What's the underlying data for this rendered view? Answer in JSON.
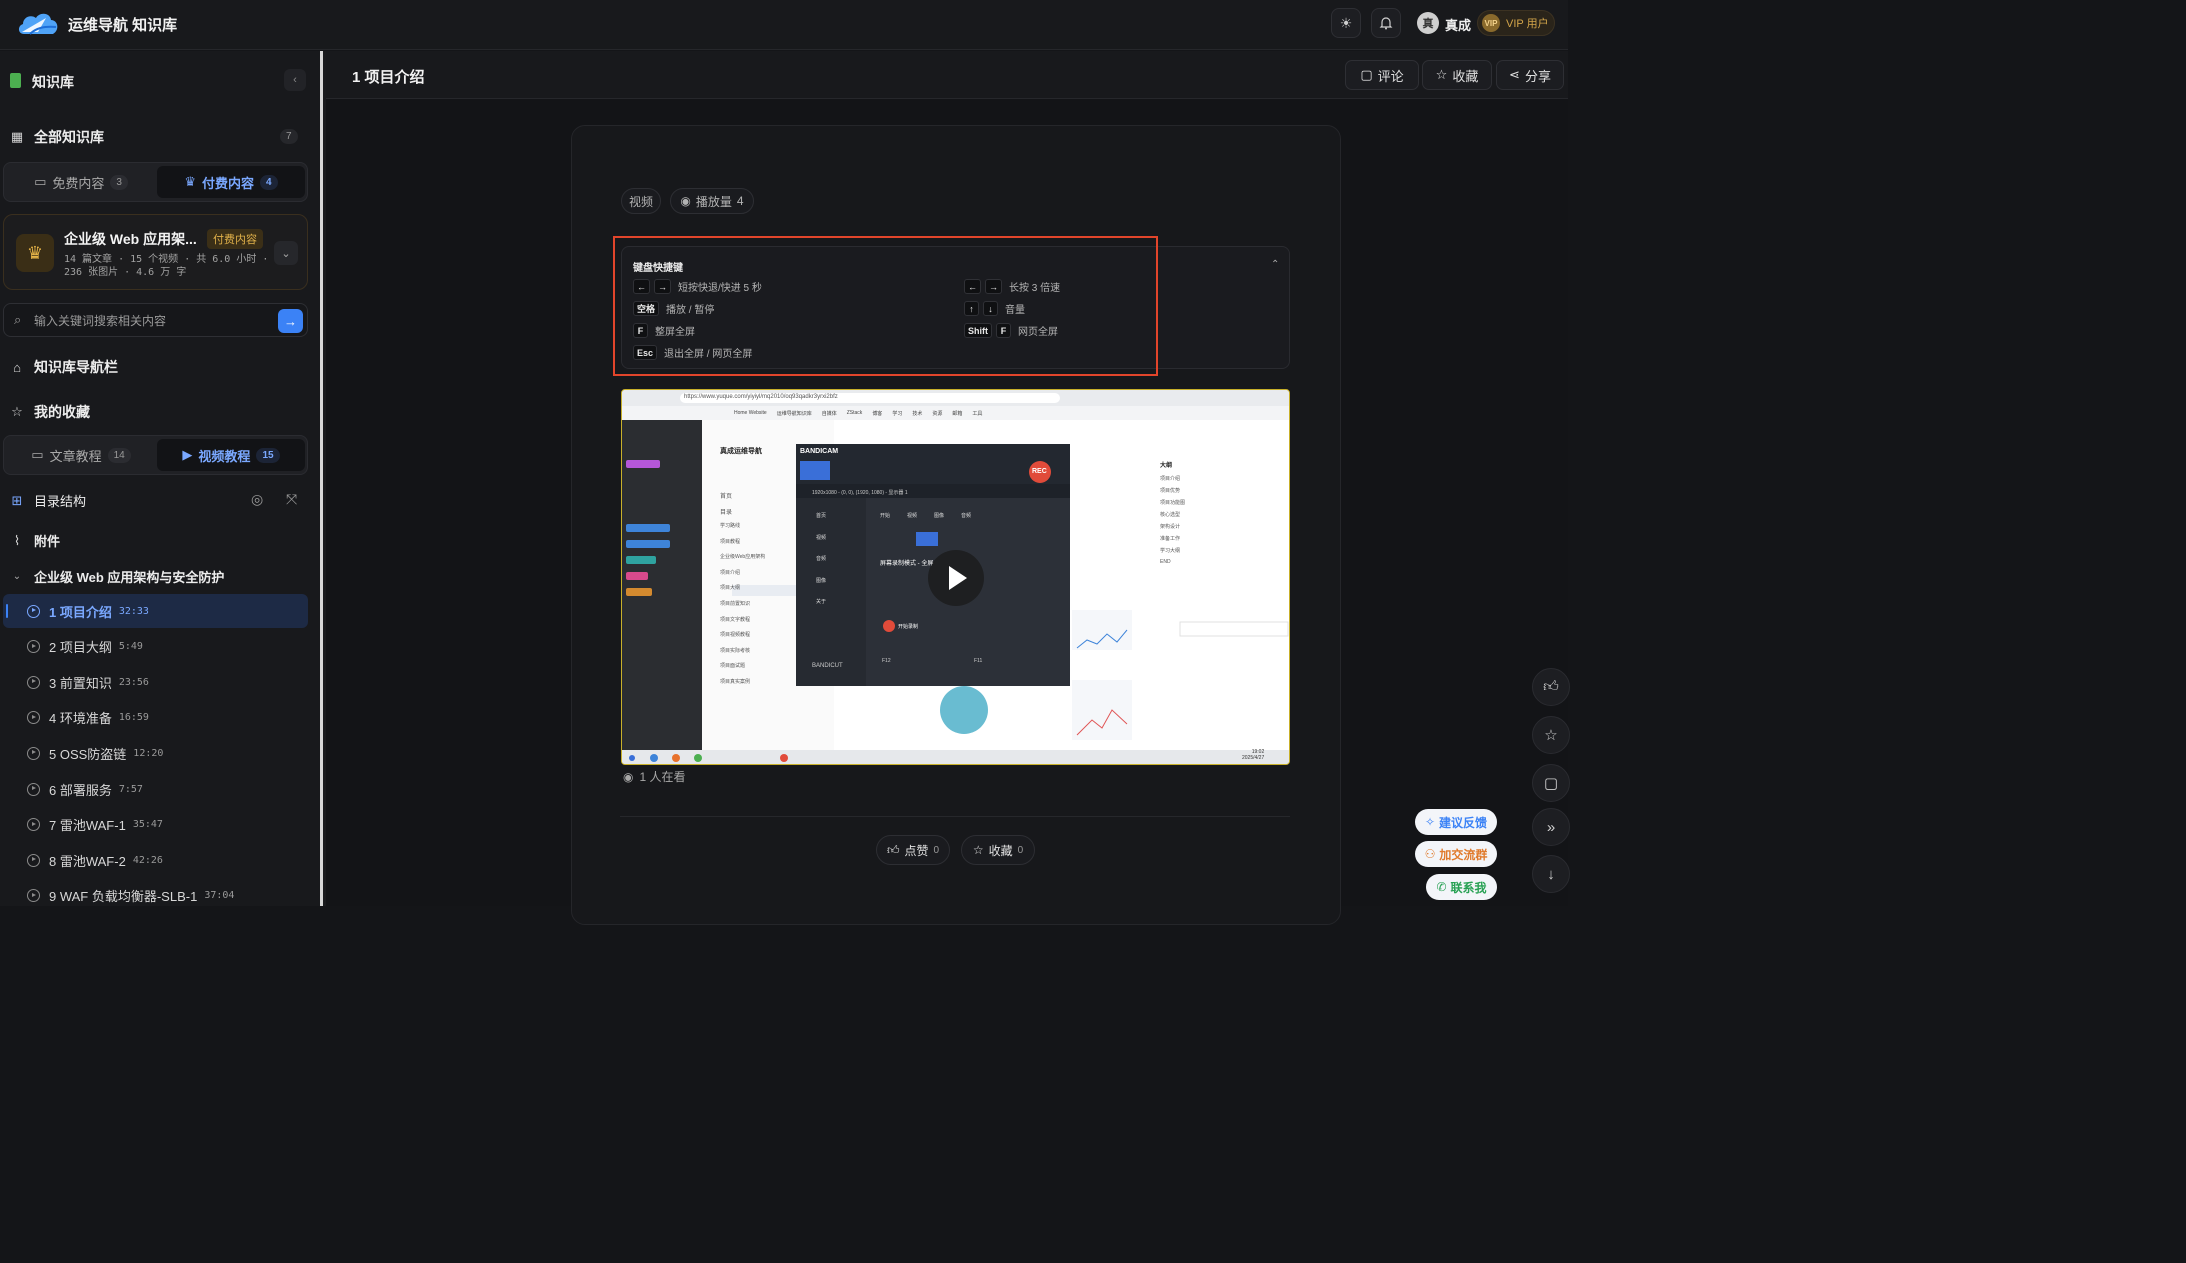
{
  "header": {
    "site_title": "运维导航 知识库",
    "user_initial": "真",
    "user_name": "真成",
    "vip_icon_text": "VIP",
    "vip_label": "VIP 用户",
    "icons": [
      "cloud-logo-icon",
      "sun-icon",
      "bell-icon"
    ]
  },
  "sidebar": {
    "title": "知识库",
    "all_label": "全部知识库",
    "all_count": "7",
    "content_tabs": [
      {
        "label": "免费内容",
        "count": "3",
        "active": false
      },
      {
        "label": "付费内容",
        "count": "4",
        "active": true
      }
    ],
    "course": {
      "title": "企业级 Web 应用架...",
      "badge": "付费内容",
      "meta": "14 篇文章 · 15 个视频 · 共 6.0 小时 · 236 张图片 · 4.6 万 字"
    },
    "search_placeholder": "输入关键词搜索相关内容",
    "nav_label": "知识库导航栏",
    "favorites_label": "我的收藏",
    "type_tabs": [
      {
        "label": "文章教程",
        "count": "14",
        "active": false
      },
      {
        "label": "视频教程",
        "count": "15",
        "active": true
      }
    ],
    "toc_label": "目录结构",
    "attachments_label": "附件",
    "section_title": "企业级 Web 应用架构与安全防护",
    "lessons": [
      {
        "title": "1 项目介绍",
        "duration": "32:33",
        "active": true
      },
      {
        "title": "2 项目大纲",
        "duration": "5:49",
        "active": false
      },
      {
        "title": "3 前置知识",
        "duration": "23:56",
        "active": false
      },
      {
        "title": "4 环境准备",
        "duration": "16:59",
        "active": false
      },
      {
        "title": "5 OSS防盗链",
        "duration": "12:20",
        "active": false
      },
      {
        "title": "6 部署服务",
        "duration": "7:57",
        "active": false
      },
      {
        "title": "7 雷池WAF-1",
        "duration": "35:47",
        "active": false
      },
      {
        "title": "8 雷池WAF-2",
        "duration": "42:26",
        "active": false
      },
      {
        "title": "9 WAF 负载均衡器-SLB-1",
        "duration": "37:04",
        "active": false
      }
    ]
  },
  "main": {
    "page_title": "1 项目介绍",
    "actions": {
      "comment": "评论",
      "favorite": "收藏",
      "share": "分享"
    },
    "tags": {
      "type": "视频",
      "views_label": "播放量",
      "views": "4"
    },
    "shortcuts": {
      "title": "键盘快捷键",
      "items": [
        {
          "keys": [
            "←",
            "→"
          ],
          "desc": "短按快退/快进 5 秒"
        },
        {
          "keys": [
            "←",
            "→"
          ],
          "desc": "长按 3 倍速"
        },
        {
          "keys": [
            "空格"
          ],
          "desc": "播放 / 暂停"
        },
        {
          "keys": [
            "↑",
            "↓"
          ],
          "desc": "音量"
        },
        {
          "keys": [
            "F"
          ],
          "desc": "整屏全屏"
        },
        {
          "keys": [
            "Shift",
            "F"
          ],
          "desc": "网页全屏"
        },
        {
          "keys": [
            "Esc"
          ],
          "desc": "退出全屏 / 网页全屏"
        }
      ]
    },
    "video": {
      "watching": "1 人在看",
      "url": "https://www.yuque.com/yiyiyl/mq2010/oq93qadkr3yrxi2bfz",
      "browser_bookmarks": [
        "Home Website",
        "运维导航知识库",
        "自媒体",
        "ZStack",
        "博客",
        "学习",
        "技术",
        "资源",
        "邮箱",
        "工具"
      ],
      "yuque_space": "真成运维导航",
      "yuque_menu": [
        "首页",
        "目录"
      ],
      "yuque_tree": [
        "学习路线",
        "项目教程",
        "企业级Web应用架构",
        "项目介绍",
        "项目大纲",
        "项目前置知识",
        "项目文字教程",
        "项目视频教程",
        "项目实际考核",
        "项目面试题",
        "项目真实案例"
      ],
      "outline_title": "大纲",
      "outline_items": [
        "项目介绍",
        "项目优势",
        "项目功能图",
        "核心选型",
        "架构设计",
        "准备工作",
        "学习大纲",
        "END"
      ],
      "bandicam_title": "BANDICAM",
      "bandicam_rec": "REC",
      "bandicam_res": "1920x1080 - (0, 0), (1920, 1080) - 显示器 1",
      "bandicam_menu": [
        "首页",
        "视频",
        "音频",
        "图像",
        "关于"
      ],
      "bandicam_tabs": [
        "开始",
        "视频",
        "图像",
        "音频"
      ],
      "bandicam_mode_title": "屏幕录制模式 - 全屏",
      "bandicam_start": "开始录制",
      "bandicam_cut": "BANDICUT",
      "bandicam_hotkey1": "F12",
      "bandicam_hotkey2": "F11",
      "taskbar_time": "19:02",
      "taskbar_date": "2025/4/27"
    },
    "like_label": "点赞",
    "like_count": "0",
    "fav_label": "收藏",
    "fav_count": "0"
  },
  "floating": {
    "feedback": "建议反馈",
    "join_group": "加交流群",
    "contact": "联系我"
  },
  "colors": {
    "accent": "#3b82f6",
    "highlight_box": "#e2452b",
    "gold": "#e0b04a",
    "background": "#141518"
  }
}
